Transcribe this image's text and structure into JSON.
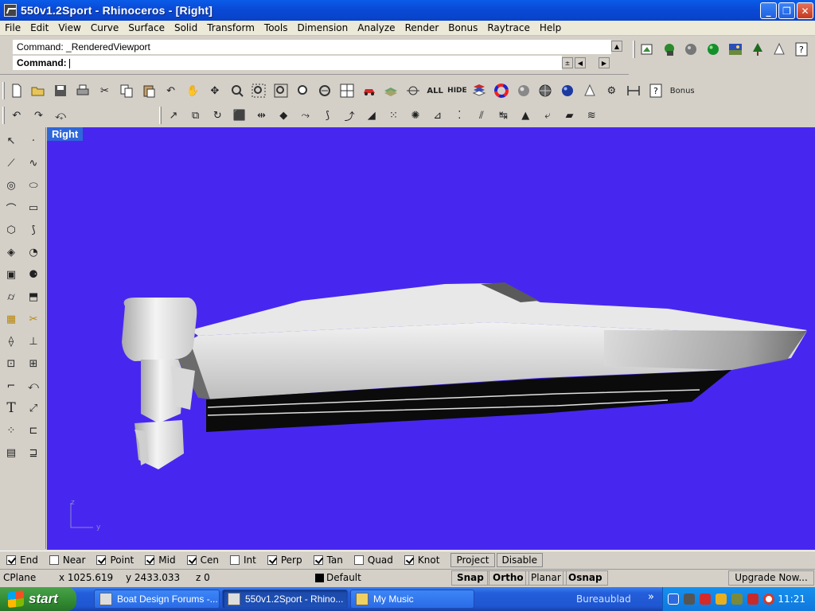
{
  "window": {
    "title": "550v1.2Sport - Rhinoceros - [Right]",
    "minimize": "_",
    "maximize": "❐",
    "close": "✕"
  },
  "menu": [
    "File",
    "Edit",
    "View",
    "Curve",
    "Surface",
    "Solid",
    "Transform",
    "Tools",
    "Dimension",
    "Analyze",
    "Render",
    "Bonus",
    "Raytrace",
    "Help"
  ],
  "command": {
    "history": "Command: _RenderedViewport",
    "prompt": "Command:",
    "value": ""
  },
  "toolbar_text": {
    "all": "ALL",
    "hide": "HIDE",
    "bonus": "Bonus"
  },
  "viewport": {
    "label": "Right",
    "background": "#4727f0",
    "axis_z": "z",
    "axis_y": "y"
  },
  "osnap": [
    {
      "label": "End",
      "checked": true
    },
    {
      "label": "Near",
      "checked": false
    },
    {
      "label": "Point",
      "checked": true
    },
    {
      "label": "Mid",
      "checked": true
    },
    {
      "label": "Cen",
      "checked": true
    },
    {
      "label": "Int",
      "checked": false
    },
    {
      "label": "Perp",
      "checked": true
    },
    {
      "label": "Tan",
      "checked": true
    },
    {
      "label": "Quad",
      "checked": false
    },
    {
      "label": "Knot",
      "checked": true
    }
  ],
  "osnap_buttons": {
    "project": "Project",
    "disable": "Disable"
  },
  "status": {
    "cplane": "CPlane",
    "x": "x 1025.619",
    "y": "y 2433.033",
    "z": "z 0",
    "layer": "Default",
    "snap": "Snap",
    "ortho": "Ortho",
    "planar": "Planar",
    "osnap": "Osnap",
    "upgrade": "Upgrade Now..."
  },
  "taskbar": {
    "start": "start",
    "tasks": [
      {
        "label": "Boat Design Forums -...",
        "active": false
      },
      {
        "label": "550v1.2Sport - Rhino...",
        "active": true
      },
      {
        "label": "My Music",
        "active": false
      }
    ],
    "desk": "Bureaublad",
    "desk_chevron": "»",
    "clock": "11:21"
  }
}
